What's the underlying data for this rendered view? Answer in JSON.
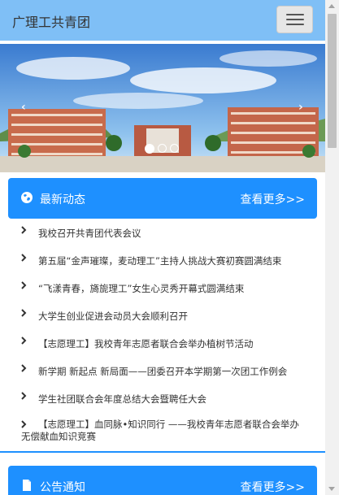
{
  "navbar": {
    "brand": "广理工共青团",
    "toggle_icon": "hamburger-icon"
  },
  "carousel": {
    "slides": 3,
    "active_slide": 1,
    "prev_icon": "chevron-left-icon",
    "next_icon": "chevron-right-icon",
    "prev_glyph": "‹",
    "next_glyph": "›"
  },
  "news_panel": {
    "title": "最新动态",
    "more": "查看更多>>",
    "icon": "globe-icon",
    "items": [
      "我校召开共青团代表会议",
      "第五届“金声璀璨，麦动理工”主持人挑战大赛初赛圆满结束",
      "“飞漾青春，旖旎理工”女生心灵秀开幕式圆满结束",
      "大学生创业促进会动员大会顺利召开",
      "【志愿理工】我校青年志愿者联合会举办植树节活动",
      "新学期 新起点 新局面——团委召开本学期第一次团工作例会",
      "学生社团联合会年度总结大会暨聘任大会",
      "【志愿理工】血同脉•知识同行 ——我校青年志愿者联合会举办无偿献血知识竞赛"
    ]
  },
  "notice_panel": {
    "title": "公告通知",
    "more": "查看更多>>",
    "icon": "document-icon"
  },
  "colors": {
    "navbar": "#7fbff6",
    "panel_header": "#1e90ff",
    "text": "#333333"
  }
}
